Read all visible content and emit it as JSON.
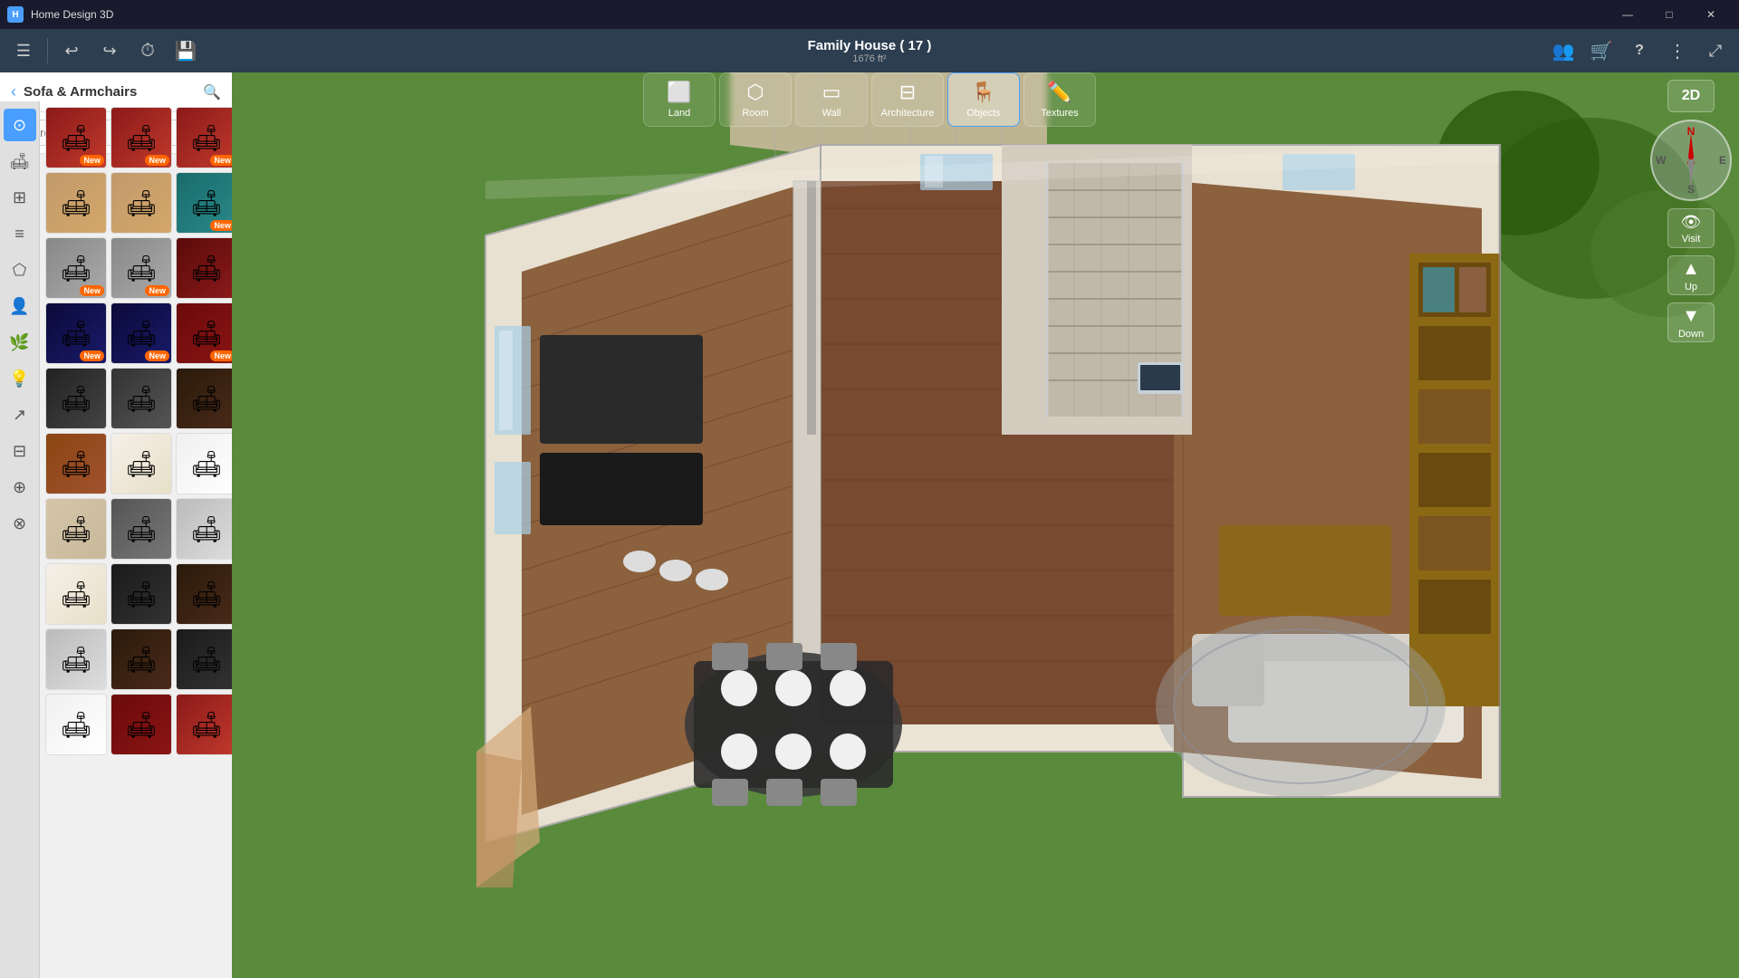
{
  "app": {
    "title": "Home Design 3D",
    "project_title": "Family House ( 17 )",
    "project_subtitle": "1676 ft²"
  },
  "window_controls": {
    "minimize": "—",
    "maximize": "□",
    "close": "✕"
  },
  "toolbar": {
    "menu_label": "☰",
    "undo_label": "↩",
    "redo_label": "↪",
    "history_label": "⏱",
    "save_label": "💾",
    "people_label": "👥",
    "cart_label": "🛒",
    "help_label": "?",
    "more_label": "⋮",
    "fullscreen_label": "⤢"
  },
  "mode_tabs": [
    {
      "id": "land",
      "label": "Land",
      "icon": "⬜"
    },
    {
      "id": "room",
      "label": "Room",
      "icon": "⬡"
    },
    {
      "id": "wall",
      "label": "Wall",
      "icon": "▭"
    },
    {
      "id": "architecture",
      "label": "Architecture",
      "icon": "⊟"
    },
    {
      "id": "objects",
      "label": "Objects",
      "icon": "🪑",
      "active": true
    },
    {
      "id": "textures",
      "label": "Textures",
      "icon": "✏️"
    }
  ],
  "sidebar": {
    "category": "Sofa & Armchairs",
    "search_placeholder": "Search",
    "nav_icons": [
      {
        "id": "home",
        "icon": "⊙",
        "active": true
      },
      {
        "id": "living",
        "icon": "🛋"
      },
      {
        "id": "grid",
        "icon": "⊞"
      },
      {
        "id": "layers",
        "icon": "≡"
      },
      {
        "id": "shape",
        "icon": "⬠"
      },
      {
        "id": "person",
        "icon": "👤"
      },
      {
        "id": "plant",
        "icon": "🌿"
      },
      {
        "id": "light",
        "icon": "💡"
      },
      {
        "id": "stairs",
        "icon": "↗"
      },
      {
        "id": "fence",
        "icon": "⊟"
      },
      {
        "id": "group",
        "icon": "⊕"
      },
      {
        "id": "misc",
        "icon": "⊗"
      }
    ],
    "items": [
      [
        {
          "color": "sofa-red",
          "new": true
        },
        {
          "color": "sofa-red",
          "new": true
        },
        {
          "color": "sofa-red",
          "new": true
        }
      ],
      [
        {
          "color": "sofa-tan",
          "new": false
        },
        {
          "color": "sofa-tan",
          "new": false
        },
        {
          "color": "sofa-teal",
          "new": true
        }
      ],
      [
        {
          "color": "sofa-gray",
          "new": true
        },
        {
          "color": "sofa-gray",
          "new": true
        },
        {
          "color": "sofa-dark-red",
          "new": false
        }
      ],
      [
        {
          "color": "sofa-navy",
          "new": true
        },
        {
          "color": "sofa-navy",
          "new": true
        },
        {
          "color": "sofa-maroon",
          "new": true
        }
      ],
      [
        {
          "color": "sofa-dark-gray",
          "new": false
        },
        {
          "color": "sofa-charcoal",
          "new": false
        },
        {
          "color": "sofa-dark-brown",
          "new": false
        }
      ],
      [
        {
          "color": "sofa-brown",
          "new": false
        },
        {
          "color": "sofa-cream",
          "new": false
        },
        {
          "color": "sofa-white",
          "new": false
        }
      ],
      [
        {
          "color": "sofa-beige",
          "new": false
        },
        {
          "color": "sofa-medium-gray",
          "new": false
        },
        {
          "color": "sofa-light-gray",
          "new": false
        }
      ],
      [
        {
          "color": "sofa-cream",
          "new": false
        },
        {
          "color": "sofa-dark",
          "new": false
        },
        {
          "color": "sofa-dark-brown",
          "new": false
        }
      ],
      [
        {
          "color": "sofa-light-gray",
          "new": false
        },
        {
          "color": "sofa-dark-brown",
          "new": false
        },
        {
          "color": "sofa-dark",
          "new": false
        }
      ],
      [
        {
          "color": "sofa-white",
          "new": false
        },
        {
          "color": "sofa-maroon",
          "new": false
        },
        {
          "color": "sofa-red",
          "new": false
        }
      ]
    ]
  },
  "view": {
    "compass": {
      "n": "N",
      "s": "S",
      "e": "E",
      "w": "W"
    },
    "mode_2d": "2D",
    "visit_label": "Visit",
    "up_label": "Up",
    "down_label": "Down"
  },
  "new_badge_text": "New"
}
